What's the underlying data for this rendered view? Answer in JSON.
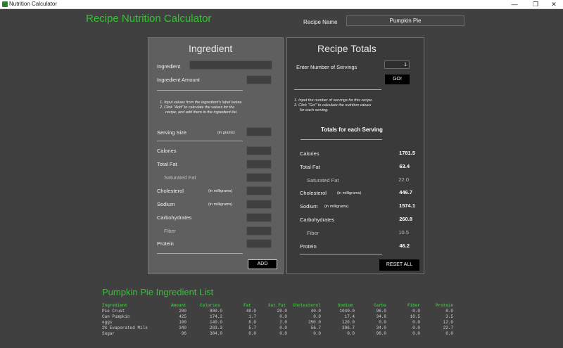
{
  "window": {
    "title": "Nutrition Calculator",
    "minimize_icon": "minimize-icon",
    "maximize_icon": "maximize-icon",
    "close_icon": "close-icon",
    "minimize_glyph": "—",
    "maximize_glyph": "❐",
    "close_glyph": "✕"
  },
  "header": {
    "app_title": "Recipe Nutrition Calculator",
    "recipe_name_label": "Recipe Name",
    "recipe_name_value": "Pumpkin Pie"
  },
  "ingredient_panel": {
    "title": "Ingredient",
    "ingredient_label": "Ingredient",
    "ingredient_value": "",
    "amount_label": "Ingredient Amount",
    "amount_value": "",
    "note_line1": "1. Input values from the ingredient's label below.",
    "note_line2": "2. Click \"Add\" to calculate the values for the",
    "note_line3": "recipe, and add them to the ingredient list.",
    "serving_size_label": "Serving Size",
    "serving_size_unit": "(in grams)",
    "calories_label": "Calories",
    "total_fat_label": "Total Fat",
    "saturated_fat_label": "Saturated Fat",
    "cholesterol_label": "Cholesterol",
    "cholesterol_unit": "(in milligrams)",
    "sodium_label": "Sodium",
    "sodium_unit": "(in milligrams)",
    "carbohydrates_label": "Carbohydrates",
    "fiber_label": "Fiber",
    "protein_label": "Protein",
    "add_button": "ADD"
  },
  "totals_panel": {
    "title": "Recipe Totals",
    "servings_label": "Enter Number of Servings",
    "servings_value": "1",
    "go_button": "GO!",
    "note_line1": "1. Input the number of servings for this recipe.",
    "note_line2": "2. Click \"Go!\" to calculate the nutrition values",
    "note_line3": "for each serving.",
    "per_serving_header": "Totals for each Serving",
    "calories_label": "Calories",
    "calories_value": "1781.5",
    "total_fat_label": "Total Fat",
    "total_fat_value": "63.4",
    "saturated_fat_label": "Saturated Fat",
    "saturated_fat_value": "22.0",
    "cholesterol_label": "Cholesterol",
    "cholesterol_unit": "(in milligrams)",
    "cholesterol_value": "446.7",
    "sodium_label": "Sodium",
    "sodium_unit": "(in milligrams)",
    "sodium_value": "1574.1",
    "carbohydrates_label": "Carbohydrates",
    "carbohydrates_value": "260.8",
    "fiber_label": "Fiber",
    "fiber_value": "10.5",
    "protein_label": "Protein",
    "protein_value": "46.2",
    "reset_button": "RESET ALL"
  },
  "ingredient_list": {
    "title": "Pumpkin Pie Ingredient List",
    "columns": [
      "Ingredient",
      "Amount",
      "Calories",
      "Fat",
      "Sat.Fat",
      "Cholesterol",
      "Sodium",
      "Carbs",
      "Fiber",
      "Protein"
    ],
    "rows": [
      [
        "Pie Crust",
        "200",
        "800.0",
        "48.0",
        "20.0",
        "40.0",
        "1040.0",
        "96.0",
        "0.0",
        "8.0"
      ],
      [
        "Can Pumpkin",
        "425",
        "174.2",
        "1.7",
        "0.0",
        "0.0",
        "17.4",
        "34.8",
        "10.5",
        "3.5"
      ],
      [
        "eggs",
        "100",
        "140.0",
        "8.0",
        "2.0",
        "350.0",
        "120.0",
        "0.0",
        "0.0",
        "12.0"
      ],
      [
        "2% Evaporated Milk",
        "340",
        "283.3",
        "5.7",
        "0.0",
        "56.7",
        "396.7",
        "34.0",
        "0.0",
        "22.7"
      ],
      [
        "Sugar",
        "96",
        "384.0",
        "0.0",
        "0.0",
        "0.0",
        "0.0",
        "96.0",
        "0.0",
        "0.0"
      ]
    ]
  },
  "colors": {
    "accent_green": "#35c135",
    "background": "#404040",
    "left_panel": "#5f5f5f",
    "right_panel": "#3a3a3a"
  }
}
